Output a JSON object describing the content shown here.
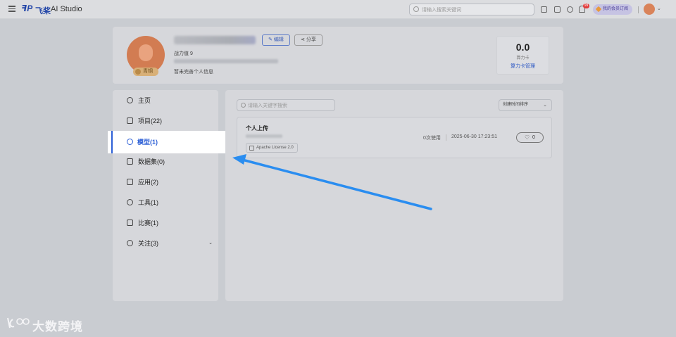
{
  "topbar": {
    "logo_mark": "飞桨",
    "app_title": "AI Studio",
    "search_placeholder": "请输入搜索关键词",
    "notification_count": "99",
    "subscribe_label": "我的会员订阅"
  },
  "profile": {
    "power_label": "战力值 9",
    "bio": "暂未完善个人信息",
    "rank": "青铜",
    "edit_label": "编辑",
    "share_label": "分享",
    "compute_value": "0.0",
    "compute_label": "算力卡",
    "compute_link": "算力卡管理"
  },
  "sidebar": {
    "items": [
      {
        "label": "主页",
        "icon": "home-icon"
      },
      {
        "label": "项目(22)",
        "icon": "project-icon"
      },
      {
        "label": "模型(1)",
        "icon": "model-icon",
        "active": true
      },
      {
        "label": "数据集(0)",
        "icon": "dataset-icon"
      },
      {
        "label": "应用(2)",
        "icon": "app-icon"
      },
      {
        "label": "工具(1)",
        "icon": "tool-icon"
      },
      {
        "label": "比赛(1)",
        "icon": "trophy-icon"
      },
      {
        "label": "关注(3)",
        "icon": "user-icon"
      }
    ],
    "caret": "⌄"
  },
  "main": {
    "search_placeholder": "请输入关键字搜索",
    "sort_label": "创建时间排序",
    "model": {
      "title": "个人上传",
      "license": "Apache License 2.0",
      "usage": "0次使用",
      "date": "2025-06-30 17:23:51",
      "likes": "0"
    }
  },
  "watermark": "大数跨境",
  "colors": {
    "accent": "#2c5fd6",
    "arrow": "#2a8df0",
    "avatar": "#d27c52"
  }
}
